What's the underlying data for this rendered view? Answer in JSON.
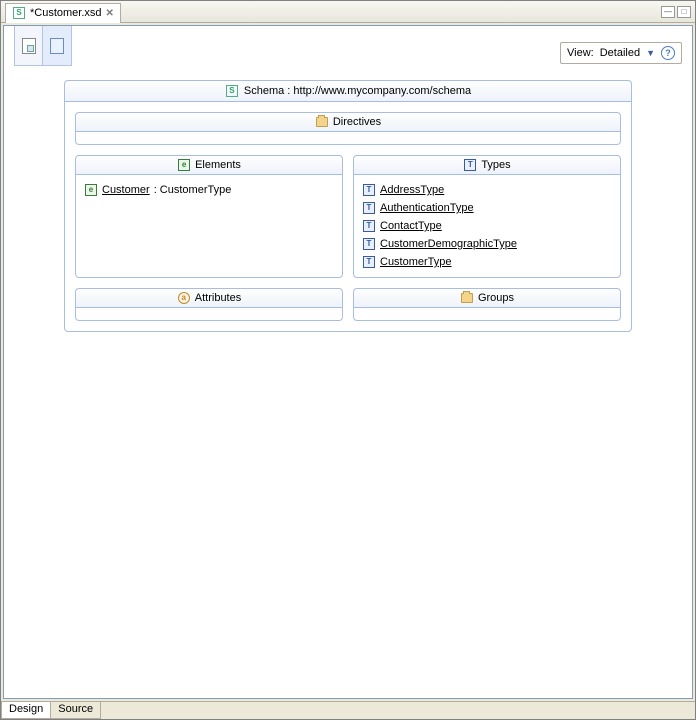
{
  "window": {
    "title": "*Customer.xsd"
  },
  "toolbar": {
    "view_label": "View:",
    "view_value": "Detailed"
  },
  "schema": {
    "header_label": "Schema : http://www.mycompany.com/schema"
  },
  "sections": {
    "directives": {
      "title": "Directives"
    },
    "elements": {
      "title": "Elements",
      "items": [
        {
          "name": "Customer",
          "suffix": " : CustomerType"
        }
      ]
    },
    "types": {
      "title": "Types",
      "items": [
        {
          "name": "AddressType"
        },
        {
          "name": "AuthenticationType"
        },
        {
          "name": "ContactType"
        },
        {
          "name": "CustomerDemographicType"
        },
        {
          "name": "CustomerType"
        }
      ]
    },
    "attributes": {
      "title": "Attributes"
    },
    "groups": {
      "title": "Groups"
    }
  },
  "footer": {
    "tabs": [
      {
        "label": "Design",
        "active": true
      },
      {
        "label": "Source",
        "active": false
      }
    ]
  }
}
